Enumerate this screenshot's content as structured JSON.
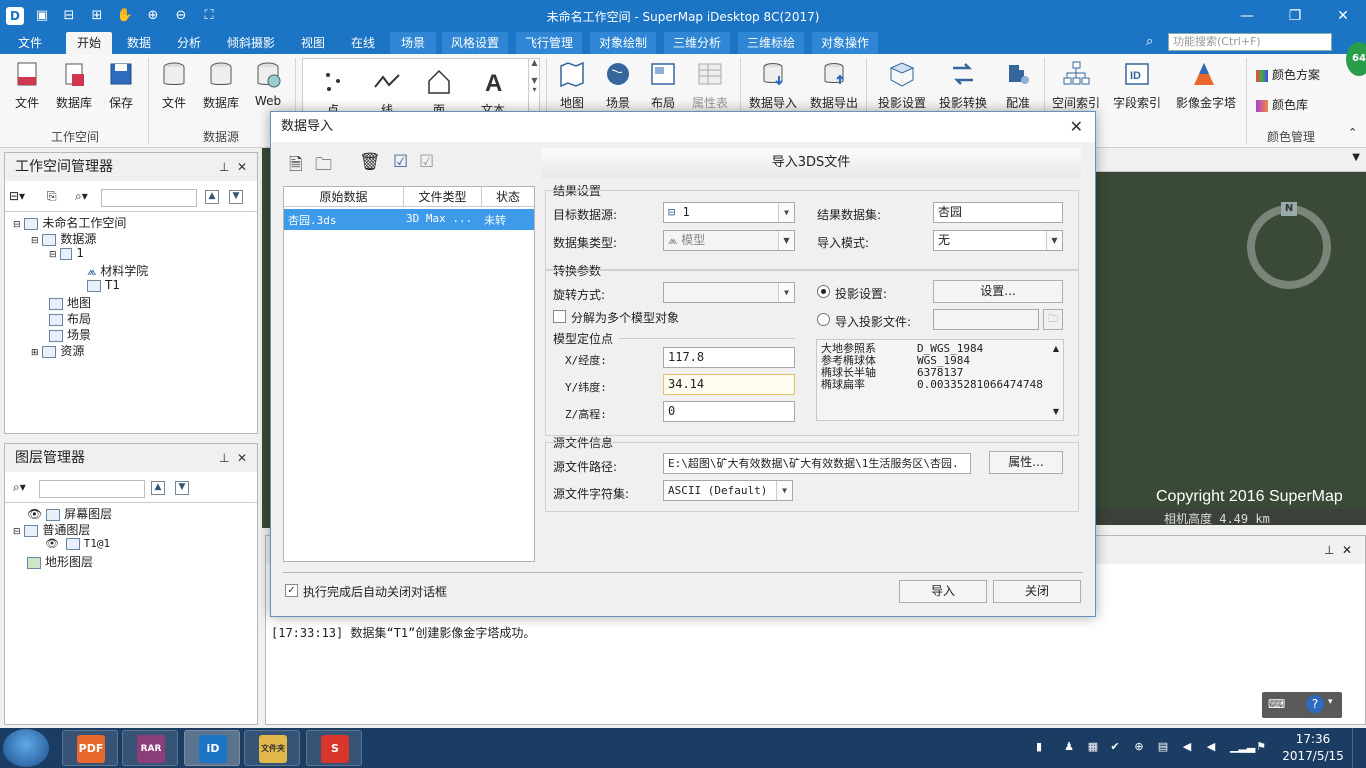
{
  "window": {
    "title": "未命名工作空间 - SuperMap iDesktop 8C(2017)",
    "app_icon": "D"
  },
  "menu_tabs": [
    "文件",
    "开始",
    "数据",
    "分析",
    "倾斜摄影",
    "视图",
    "在线",
    "场景",
    "风格设置",
    "飞行管理",
    "对象绘制",
    "三维分析",
    "三维标绘",
    "对象操作"
  ],
  "active_tab": "开始",
  "search": {
    "placeholder": "功能搜索(Ctrl+F)"
  },
  "ribbon": {
    "workspace": {
      "file": "文件",
      "database": "数据库",
      "save": "保存",
      "group": "工作空间"
    },
    "datasource": {
      "file": "文件",
      "database": "数据库",
      "web": "Web",
      "group": "数据源"
    },
    "draw": {
      "point": "点",
      "line": "线",
      "polygon": "面",
      "text": "文本"
    },
    "browse": {
      "map": "地图",
      "scene": "场景",
      "layout": "布局",
      "attr": "属性表"
    },
    "data": {
      "import": "数据导入",
      "export": "数据导出",
      "proj_set": "投影设置",
      "proj_convert": "投影转换",
      "register": "配准",
      "spatial_index": "空间索引",
      "field_index": "字段索引",
      "pyramid": "影像金字塔"
    },
    "color": {
      "scheme": "颜色方案",
      "library": "颜色库",
      "group": "颜色管理"
    }
  },
  "workspace_panel": {
    "title": "工作空间管理器",
    "tree": {
      "root": "未命名工作空间",
      "datasources": "数据源",
      "ds1": "1",
      "dataset_model": "材料学院",
      "dataset_image": "T1",
      "maps": "地图",
      "layouts": "布局",
      "scenes": "场景",
      "resources": "资源"
    }
  },
  "layer_panel": {
    "title": "图层管理器",
    "items": {
      "screen": "屏幕图层",
      "normal": "普通图层",
      "t1": "T1@1",
      "terrain": "地形图层"
    }
  },
  "scene": {
    "compass_n": "N",
    "copyright": "Copyright 2016 SuperMap",
    "camera_height": "相机高度 4.49 km"
  },
  "output": {
    "lines": [
      "[17:33:13] 数据集“T1”创建影像金字塔成功。"
    ]
  },
  "dialog": {
    "title": "数据导入",
    "file_table": {
      "headers": [
        "原始数据",
        "文件类型",
        "状态"
      ],
      "rows": [
        {
          "name": "杏园.3ds",
          "type": "3D Max ...",
          "status": "未转"
        }
      ]
    },
    "pane_title": "导入3DS文件",
    "result_section": "结果设置",
    "target_datasource_label": "目标数据源:",
    "target_datasource_value": "1",
    "result_dataset_label": "结果数据集:",
    "result_dataset_value": "杏园",
    "dataset_type_label": "数据集类型:",
    "dataset_type_value": "模型",
    "import_mode_label": "导入模式:",
    "import_mode_value": "无",
    "convert_section": "转换参数",
    "rotation_label": "旋转方式:",
    "split_label": "分解为多个模型对象",
    "proj_setting_label": "投影设置:",
    "proj_setting_button": "设置...",
    "proj_file_label": "导入投影文件:",
    "anchor_section": "模型定位点",
    "x_label": "X/经度:",
    "x_value": "117.8",
    "y_label": "Y/纬度:",
    "y_value": "34.14",
    "z_label": "Z/高程:",
    "z_value": "0",
    "proj_info": [
      {
        "k": "大地参照系",
        "v": "D_WGS_1984"
      },
      {
        "k": "参考椭球体",
        "v": "WGS_1984"
      },
      {
        "k": "椭球长半轴",
        "v": "6378137"
      },
      {
        "k": "椭球扁率",
        "v": "0.00335281066474748"
      }
    ],
    "source_section": "源文件信息",
    "source_path_label": "源文件路径:",
    "source_path_value": "E:\\超图\\矿大有效数据\\矿大有效数据\\1生活服务区\\杏园.",
    "properties_button": "属性...",
    "charset_label": "源文件字符集:",
    "charset_value": "ASCII (Default)",
    "auto_close_label": "执行完成后自动关闭对话框",
    "import_button": "导入",
    "close_button": "关闭"
  },
  "taskbar": {
    "apps": [
      "PDF",
      "RAR",
      "iD",
      "文件夹",
      "S"
    ],
    "time": "17:36",
    "date": "2017/5/15"
  },
  "colors": {
    "accent": "#1b74c4",
    "selection": "#3d9be9",
    "taskbar": "#1c3d63"
  }
}
